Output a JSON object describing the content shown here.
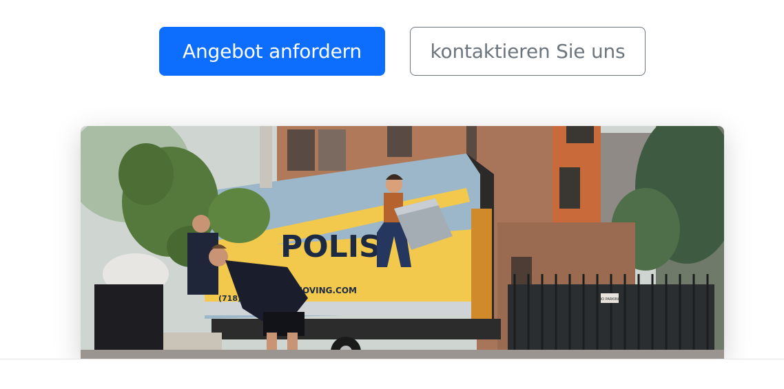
{
  "buttons": {
    "primary_label": "Angebot anfordern",
    "secondary_label": "kontaktieren Sie uns"
  },
  "hero": {
    "truck_brand": "POLIS",
    "truck_phone": "(718) 7 520",
    "truck_web": "MOVING.COM",
    "sign_text": "NO PARKING"
  },
  "colors": {
    "primary": "#0d6efd",
    "secondary": "#6c757d",
    "truck_blue": "#9bb7c9",
    "truck_yellow": "#f2c94c"
  }
}
